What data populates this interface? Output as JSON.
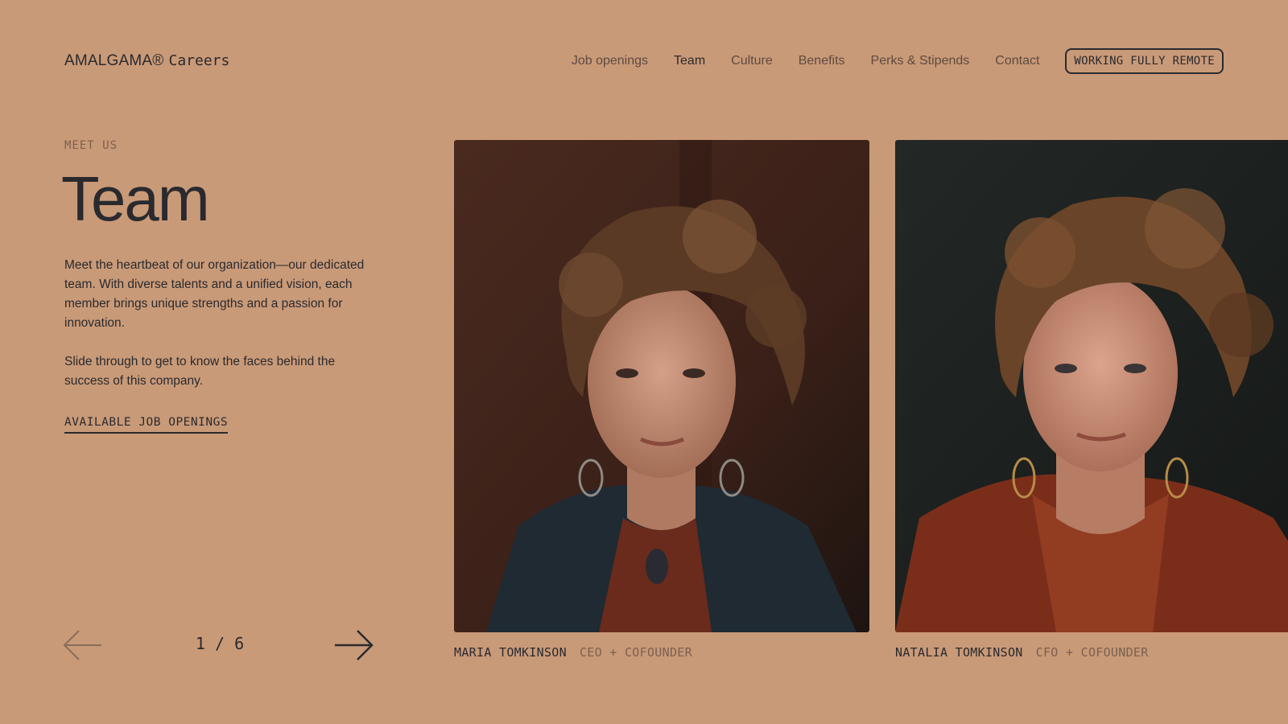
{
  "brand": {
    "name": "AMALGAMA®",
    "suffix": "Careers"
  },
  "nav": {
    "items": [
      {
        "label": "Job openings",
        "active": false
      },
      {
        "label": "Team",
        "active": true
      },
      {
        "label": "Culture",
        "active": false
      },
      {
        "label": "Benefits",
        "active": false
      },
      {
        "label": "Perks & Stipends",
        "active": false
      },
      {
        "label": "Contact",
        "active": false
      }
    ],
    "cta_label": "WORKING FULLY REMOTE"
  },
  "hero": {
    "eyebrow": "MEET US",
    "title": "Team",
    "paragraph_1": "Meet the heartbeat of our organization—our dedicated team. With diverse talents and a unified vision, each member brings unique strengths and a passion for innovation.",
    "paragraph_2": "Slide through to get to know the faces behind the success of this company.",
    "jobs_link": "AVAILABLE JOB OPENINGS"
  },
  "pager": {
    "current": "1",
    "total": "6",
    "separator": "/"
  },
  "team": [
    {
      "name": "MARIA TOMKINSON",
      "role": "CEO + COFOUNDER"
    },
    {
      "name": "NATALIA TOMKINSON",
      "role": "CFO + COFOUNDER"
    }
  ],
  "colors": {
    "background": "#c99a78",
    "text": "#2a2a2e",
    "muted": "#7b6150"
  }
}
